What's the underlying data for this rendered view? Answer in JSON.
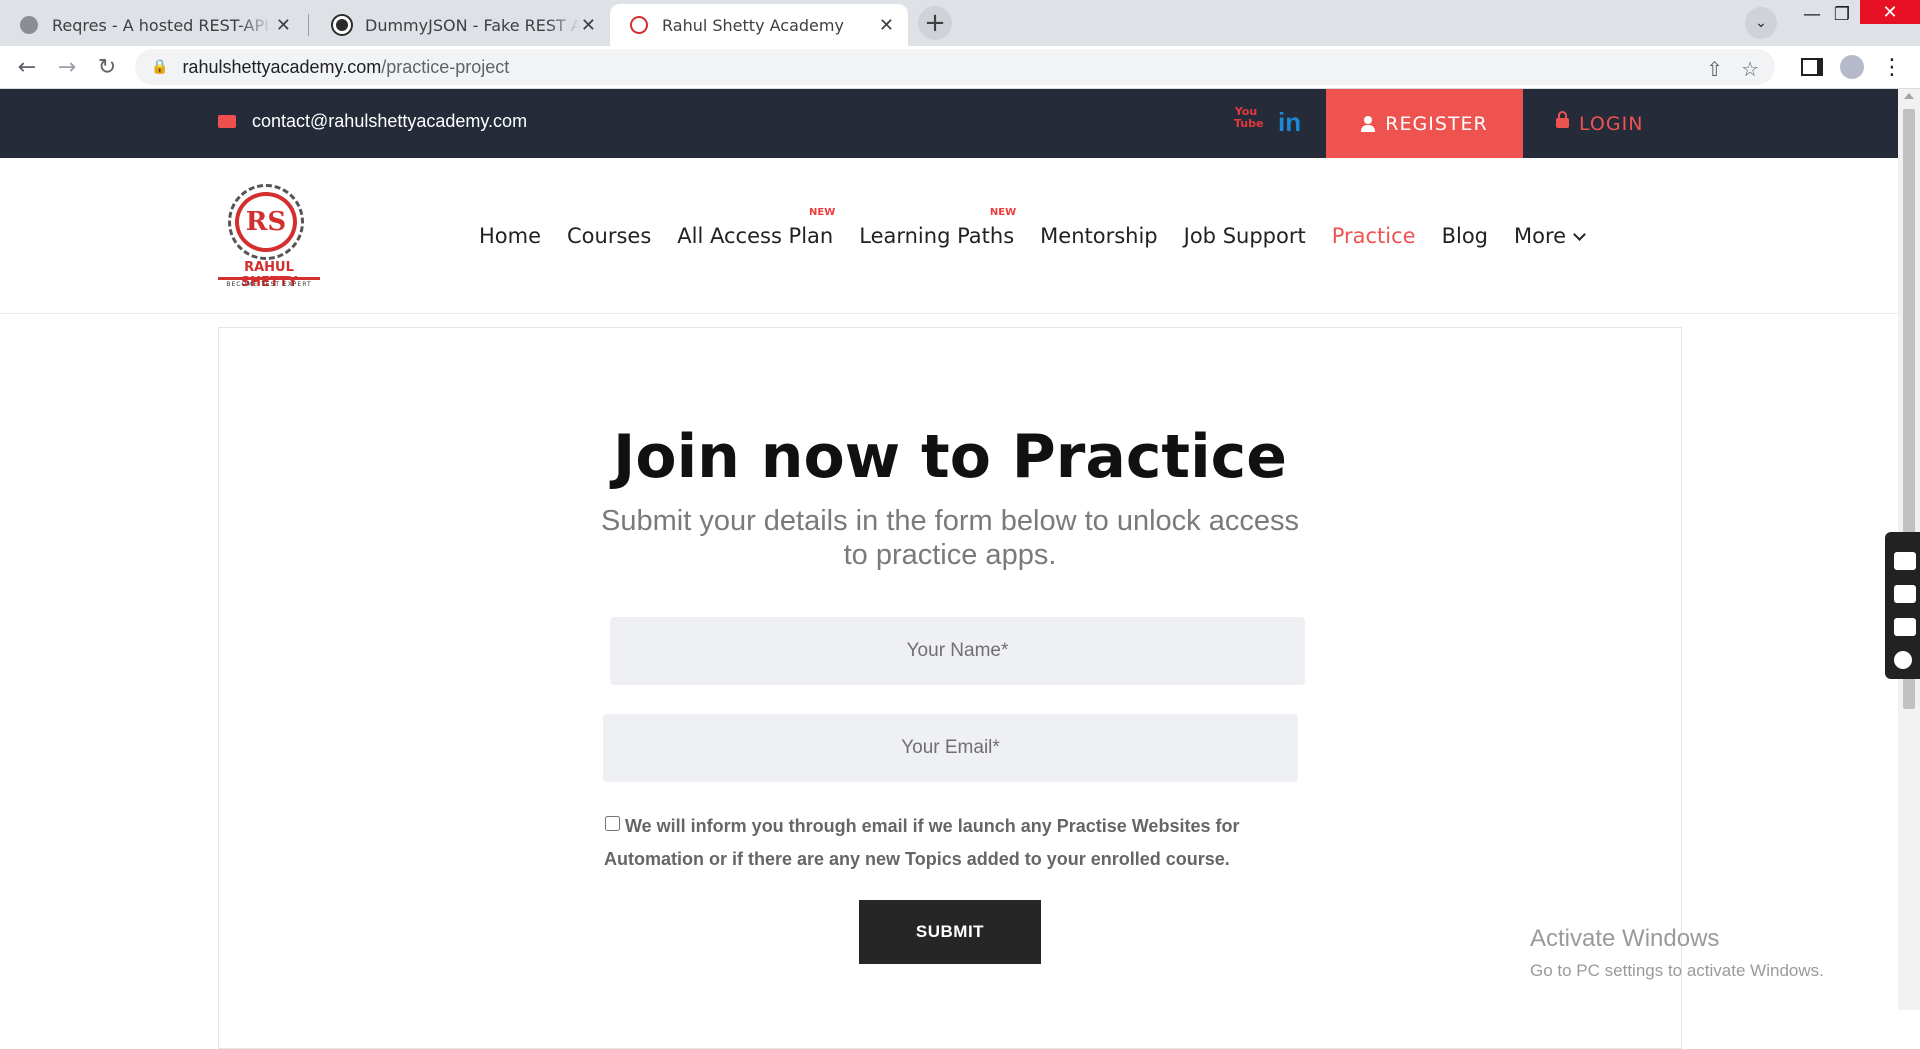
{
  "browser": {
    "tabs": [
      {
        "title": "Reqres - A hosted REST-API ready to respond",
        "active": false
      },
      {
        "title": "DummyJSON - Fake REST API of JSON data",
        "active": false
      },
      {
        "title": "Rahul Shetty Academy",
        "active": true
      }
    ],
    "url_domain": "rahulshettyacademy.com",
    "url_path": "/practice-project",
    "new_tab_symbol": "+",
    "close_symbol": "✕"
  },
  "site": {
    "email": "contact@rahulshettyacademy.com",
    "youtube_text": "You Tube",
    "linkedin_text": "in",
    "register_label": "REGISTER",
    "login_label": "LOGIN",
    "logo": {
      "monogram": "RS",
      "name": "RAHUL SHETTY",
      "tagline": "BECOME TEST EXPERT"
    },
    "nav": [
      {
        "label": "Home"
      },
      {
        "label": "Courses"
      },
      {
        "label": "All Access Plan",
        "badge": "NEW"
      },
      {
        "label": "Learning Paths",
        "badge": "NEW"
      },
      {
        "label": "Mentorship"
      },
      {
        "label": "Job Support"
      },
      {
        "label": "Practice",
        "active": true
      },
      {
        "label": "Blog"
      },
      {
        "label": "More"
      }
    ]
  },
  "form": {
    "title": "Join now to Practice",
    "subtitle": "Submit your details in the form below to unlock access to practice apps.",
    "name_placeholder": "Your Name*",
    "email_placeholder": "Your Email*",
    "consent_text": "We will inform you through email if we launch any Practise Websites for Automation or if there are any new Topics added to your enrolled course.",
    "submit_label": "SUBMIT"
  },
  "os": {
    "watermark_title": "Activate Windows",
    "watermark_sub": "Go to PC settings to activate Windows."
  },
  "colors": {
    "accent": "#ef5350",
    "topbar": "#252b38",
    "field_bg": "#eff0f3",
    "submit_bg": "#262626"
  }
}
